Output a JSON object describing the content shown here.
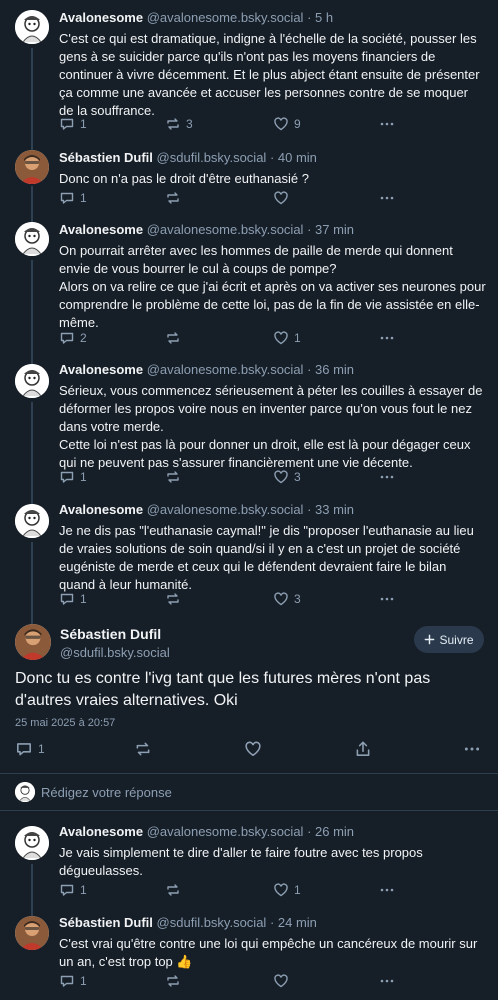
{
  "posts_above": [
    {
      "author": "Avalonesome",
      "handle": "@avalonesome.bsky.social",
      "time": "· 5 h",
      "avatar": "cartoon-avatar",
      "text": [
        "C'est ce qui est dramatique, indigne à l'échelle de la société, pousser les gens à se suicider parce qu'ils n'ont pas les moyens financiers de continuer à vivre décemment. Et le plus abject étant ensuite de présenter ça comme une avancée et accuser les personnes contre de se moquer de la souffrance."
      ],
      "replies": "1",
      "reposts": "3",
      "likes": "9"
    },
    {
      "author": "Sébastien Dufil",
      "handle": "@sdufil.bsky.social",
      "time": "· 40 min",
      "avatar": "photo-avatar",
      "text": [
        "Donc on n'a pas le droit d'être euthanasié ?"
      ],
      "replies": "1",
      "reposts": "",
      "likes": ""
    },
    {
      "author": "Avalonesome",
      "handle": "@avalonesome.bsky.social",
      "time": "· 37 min",
      "avatar": "cartoon-avatar",
      "text": [
        "On pourrait arrêter avec les hommes de paille de merde qui donnent envie de vous bourrer le cul à coups de pompe?",
        "Alors on va relire ce que j'ai écrit et après on va activer ses neurones pour comprendre le problème de cette loi, pas de la fin de vie assistée en elle-même."
      ],
      "replies": "2",
      "reposts": "",
      "likes": "1"
    },
    {
      "author": "Avalonesome",
      "handle": "@avalonesome.bsky.social",
      "time": "· 36 min",
      "avatar": "cartoon-avatar",
      "text": [
        "Sérieux, vous commencez sérieusement à péter les couilles à essayer de déformer les propos voire nous en inventer parce qu'on vous fout le nez dans votre merde.",
        "Cette loi n'est pas là pour donner un droit, elle est là pour dégager ceux qui ne peuvent pas s'assurer financièrement une vie décente."
      ],
      "replies": "1",
      "reposts": "",
      "likes": "3"
    },
    {
      "author": "Avalonesome",
      "handle": "@avalonesome.bsky.social",
      "time": "· 33 min",
      "avatar": "cartoon-avatar",
      "text": [
        "Je ne dis pas \"l'euthanasie caymal!\" je dis \"proposer l'euthanasie au lieu de vraies solutions de soin quand/si il y en a c'est un projet de société eugéniste de merde et ceux qui le défendent devraient faire le bilan quand à leur humanité."
      ],
      "replies": "1",
      "reposts": "",
      "likes": "3"
    }
  ],
  "focused": {
    "author": "Sébastien Dufil",
    "handle": "@sdufil.bsky.social",
    "follow_label": "Suivre",
    "text": "Donc tu es contre l'ivg tant que les futures mères n'ont pas d'autres vraies alternatives. Oki",
    "date": "25 mai 2025 à 20:57",
    "replies": "1"
  },
  "reply_box": {
    "placeholder": "Rédigez votre réponse"
  },
  "replies_below": [
    {
      "author": "Avalonesome",
      "handle": "@avalonesome.bsky.social",
      "time": "· 26 min",
      "avatar": "cartoon-avatar",
      "text": [
        "Je vais simplement te dire d'aller te faire foutre avec tes propos dégueulasses."
      ],
      "replies": "1",
      "reposts": "",
      "likes": "1"
    },
    {
      "author": "Sébastien Dufil",
      "handle": "@sdufil.bsky.social",
      "time": "· 24 min",
      "avatar": "photo-avatar",
      "text": [
        "C'est vrai qu'être contre une loi qui empêche un cancéreux de mourir sur un an, c'est trop top 👍"
      ],
      "replies": "1",
      "reposts": "",
      "likes": ""
    }
  ],
  "colors": {
    "background": "#161e27",
    "muted": "#8d9fb3",
    "text": "#f1f3f5"
  }
}
